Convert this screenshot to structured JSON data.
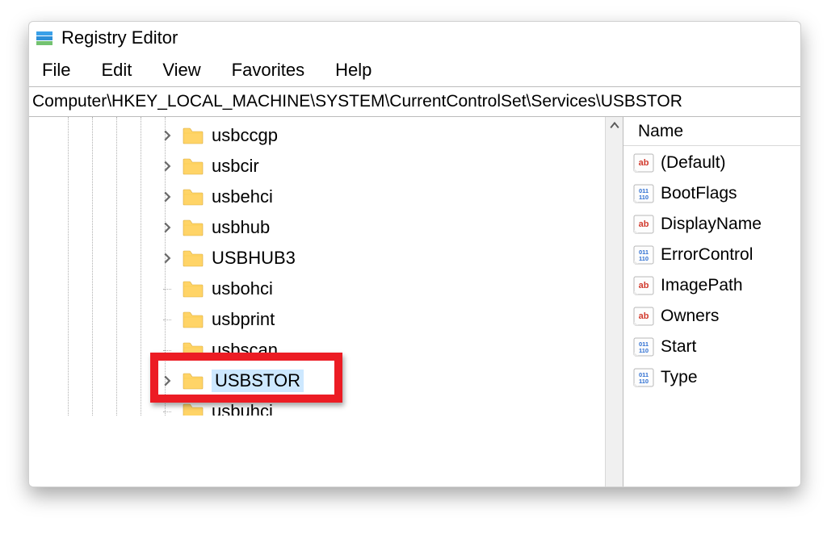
{
  "window": {
    "title": "Registry Editor"
  },
  "menu": {
    "file": "File",
    "edit": "Edit",
    "view": "View",
    "favorites": "Favorites",
    "help": "Help"
  },
  "address": {
    "path": "Computer\\HKEY_LOCAL_MACHINE\\SYSTEM\\CurrentControlSet\\Services\\USBSTOR"
  },
  "tree": [
    {
      "name": "usbccgp",
      "expandable": true
    },
    {
      "name": "usbcir",
      "expandable": true
    },
    {
      "name": "usbehci",
      "expandable": true
    },
    {
      "name": "usbhub",
      "expandable": true
    },
    {
      "name": "USBHUB3",
      "expandable": true
    },
    {
      "name": "usbohci",
      "expandable": false
    },
    {
      "name": "usbprint",
      "expandable": false
    },
    {
      "name": "usbscan",
      "expandable": false
    },
    {
      "name": "USBSTOR",
      "expandable": true,
      "selected": true,
      "highlighted": true
    },
    {
      "name": "usbuhci",
      "expandable": false
    }
  ],
  "list": {
    "header_name": "Name",
    "items": [
      {
        "name": "(Default)",
        "type": "string"
      },
      {
        "name": "BootFlags",
        "type": "binary"
      },
      {
        "name": "DisplayName",
        "type": "string"
      },
      {
        "name": "ErrorControl",
        "type": "binary"
      },
      {
        "name": "ImagePath",
        "type": "string"
      },
      {
        "name": "Owners",
        "type": "string"
      },
      {
        "name": "Start",
        "type": "binary"
      },
      {
        "name": "Type",
        "type": "binary"
      }
    ]
  }
}
